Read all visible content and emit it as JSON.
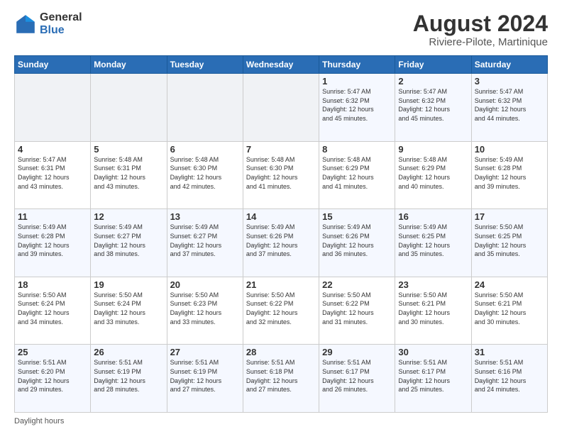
{
  "logo": {
    "general": "General",
    "blue": "Blue"
  },
  "title": "August 2024",
  "subtitle": "Riviere-Pilote, Martinique",
  "days_of_week": [
    "Sunday",
    "Monday",
    "Tuesday",
    "Wednesday",
    "Thursday",
    "Friday",
    "Saturday"
  ],
  "footer": "Daylight hours",
  "weeks": [
    [
      {
        "day": "",
        "info": ""
      },
      {
        "day": "",
        "info": ""
      },
      {
        "day": "",
        "info": ""
      },
      {
        "day": "",
        "info": ""
      },
      {
        "day": "1",
        "info": "Sunrise: 5:47 AM\nSunset: 6:32 PM\nDaylight: 12 hours\nand 45 minutes."
      },
      {
        "day": "2",
        "info": "Sunrise: 5:47 AM\nSunset: 6:32 PM\nDaylight: 12 hours\nand 45 minutes."
      },
      {
        "day": "3",
        "info": "Sunrise: 5:47 AM\nSunset: 6:32 PM\nDaylight: 12 hours\nand 44 minutes."
      }
    ],
    [
      {
        "day": "4",
        "info": "Sunrise: 5:47 AM\nSunset: 6:31 PM\nDaylight: 12 hours\nand 43 minutes."
      },
      {
        "day": "5",
        "info": "Sunrise: 5:48 AM\nSunset: 6:31 PM\nDaylight: 12 hours\nand 43 minutes."
      },
      {
        "day": "6",
        "info": "Sunrise: 5:48 AM\nSunset: 6:30 PM\nDaylight: 12 hours\nand 42 minutes."
      },
      {
        "day": "7",
        "info": "Sunrise: 5:48 AM\nSunset: 6:30 PM\nDaylight: 12 hours\nand 41 minutes."
      },
      {
        "day": "8",
        "info": "Sunrise: 5:48 AM\nSunset: 6:29 PM\nDaylight: 12 hours\nand 41 minutes."
      },
      {
        "day": "9",
        "info": "Sunrise: 5:48 AM\nSunset: 6:29 PM\nDaylight: 12 hours\nand 40 minutes."
      },
      {
        "day": "10",
        "info": "Sunrise: 5:49 AM\nSunset: 6:28 PM\nDaylight: 12 hours\nand 39 minutes."
      }
    ],
    [
      {
        "day": "11",
        "info": "Sunrise: 5:49 AM\nSunset: 6:28 PM\nDaylight: 12 hours\nand 39 minutes."
      },
      {
        "day": "12",
        "info": "Sunrise: 5:49 AM\nSunset: 6:27 PM\nDaylight: 12 hours\nand 38 minutes."
      },
      {
        "day": "13",
        "info": "Sunrise: 5:49 AM\nSunset: 6:27 PM\nDaylight: 12 hours\nand 37 minutes."
      },
      {
        "day": "14",
        "info": "Sunrise: 5:49 AM\nSunset: 6:26 PM\nDaylight: 12 hours\nand 37 minutes."
      },
      {
        "day": "15",
        "info": "Sunrise: 5:49 AM\nSunset: 6:26 PM\nDaylight: 12 hours\nand 36 minutes."
      },
      {
        "day": "16",
        "info": "Sunrise: 5:49 AM\nSunset: 6:25 PM\nDaylight: 12 hours\nand 35 minutes."
      },
      {
        "day": "17",
        "info": "Sunrise: 5:50 AM\nSunset: 6:25 PM\nDaylight: 12 hours\nand 35 minutes."
      }
    ],
    [
      {
        "day": "18",
        "info": "Sunrise: 5:50 AM\nSunset: 6:24 PM\nDaylight: 12 hours\nand 34 minutes."
      },
      {
        "day": "19",
        "info": "Sunrise: 5:50 AM\nSunset: 6:24 PM\nDaylight: 12 hours\nand 33 minutes."
      },
      {
        "day": "20",
        "info": "Sunrise: 5:50 AM\nSunset: 6:23 PM\nDaylight: 12 hours\nand 33 minutes."
      },
      {
        "day": "21",
        "info": "Sunrise: 5:50 AM\nSunset: 6:22 PM\nDaylight: 12 hours\nand 32 minutes."
      },
      {
        "day": "22",
        "info": "Sunrise: 5:50 AM\nSunset: 6:22 PM\nDaylight: 12 hours\nand 31 minutes."
      },
      {
        "day": "23",
        "info": "Sunrise: 5:50 AM\nSunset: 6:21 PM\nDaylight: 12 hours\nand 30 minutes."
      },
      {
        "day": "24",
        "info": "Sunrise: 5:50 AM\nSunset: 6:21 PM\nDaylight: 12 hours\nand 30 minutes."
      }
    ],
    [
      {
        "day": "25",
        "info": "Sunrise: 5:51 AM\nSunset: 6:20 PM\nDaylight: 12 hours\nand 29 minutes."
      },
      {
        "day": "26",
        "info": "Sunrise: 5:51 AM\nSunset: 6:19 PM\nDaylight: 12 hours\nand 28 minutes."
      },
      {
        "day": "27",
        "info": "Sunrise: 5:51 AM\nSunset: 6:19 PM\nDaylight: 12 hours\nand 27 minutes."
      },
      {
        "day": "28",
        "info": "Sunrise: 5:51 AM\nSunset: 6:18 PM\nDaylight: 12 hours\nand 27 minutes."
      },
      {
        "day": "29",
        "info": "Sunrise: 5:51 AM\nSunset: 6:17 PM\nDaylight: 12 hours\nand 26 minutes."
      },
      {
        "day": "30",
        "info": "Sunrise: 5:51 AM\nSunset: 6:17 PM\nDaylight: 12 hours\nand 25 minutes."
      },
      {
        "day": "31",
        "info": "Sunrise: 5:51 AM\nSunset: 6:16 PM\nDaylight: 12 hours\nand 24 minutes."
      }
    ]
  ]
}
